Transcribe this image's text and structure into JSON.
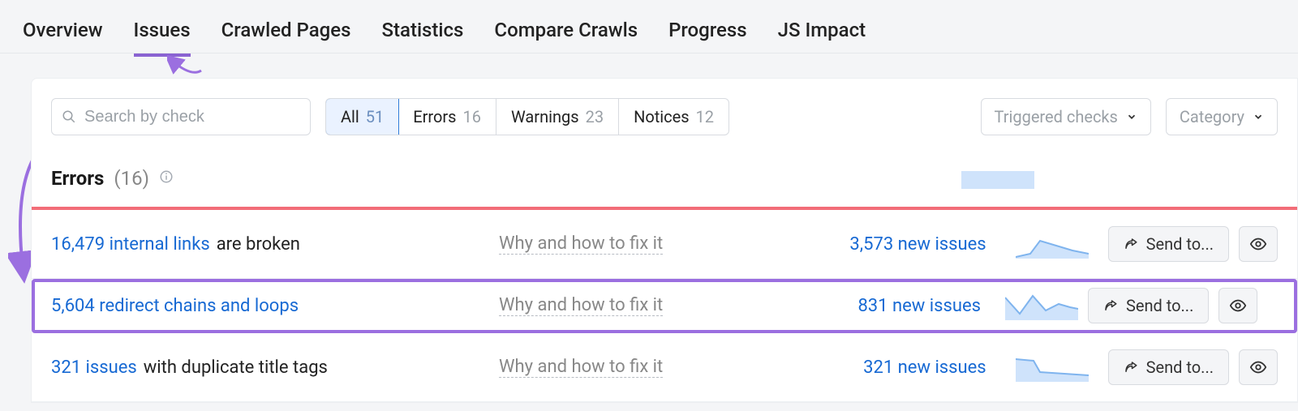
{
  "tabs": {
    "overview": "Overview",
    "issues": "Issues",
    "crawled": "Crawled Pages",
    "statistics": "Statistics",
    "compare": "Compare Crawls",
    "progress": "Progress",
    "js_impact": "JS Impact"
  },
  "search": {
    "placeholder": "Search by check"
  },
  "filters": {
    "all": {
      "label": "All",
      "count": "51"
    },
    "errors": {
      "label": "Errors",
      "count": "16"
    },
    "warnings": {
      "label": "Warnings",
      "count": "23"
    },
    "notices": {
      "label": "Notices",
      "count": "12"
    }
  },
  "dropdowns": {
    "triggered": "Triggered checks",
    "category": "Category"
  },
  "section": {
    "title": "Errors",
    "count": "(16)"
  },
  "rows": [
    {
      "link": "16,479 internal links",
      "suffix": " are broken",
      "why": "Why and how to fix it",
      "new": "3,573 new issues",
      "send": "Send to..."
    },
    {
      "link": "5,604 redirect chains and loops",
      "suffix": "",
      "why": "Why and how to fix it",
      "new": "831 new issues",
      "send": "Send to..."
    },
    {
      "link": "321 issues",
      "suffix": " with duplicate title tags",
      "why": "Why and how to fix it",
      "new": "321 new issues",
      "send": "Send to..."
    }
  ]
}
